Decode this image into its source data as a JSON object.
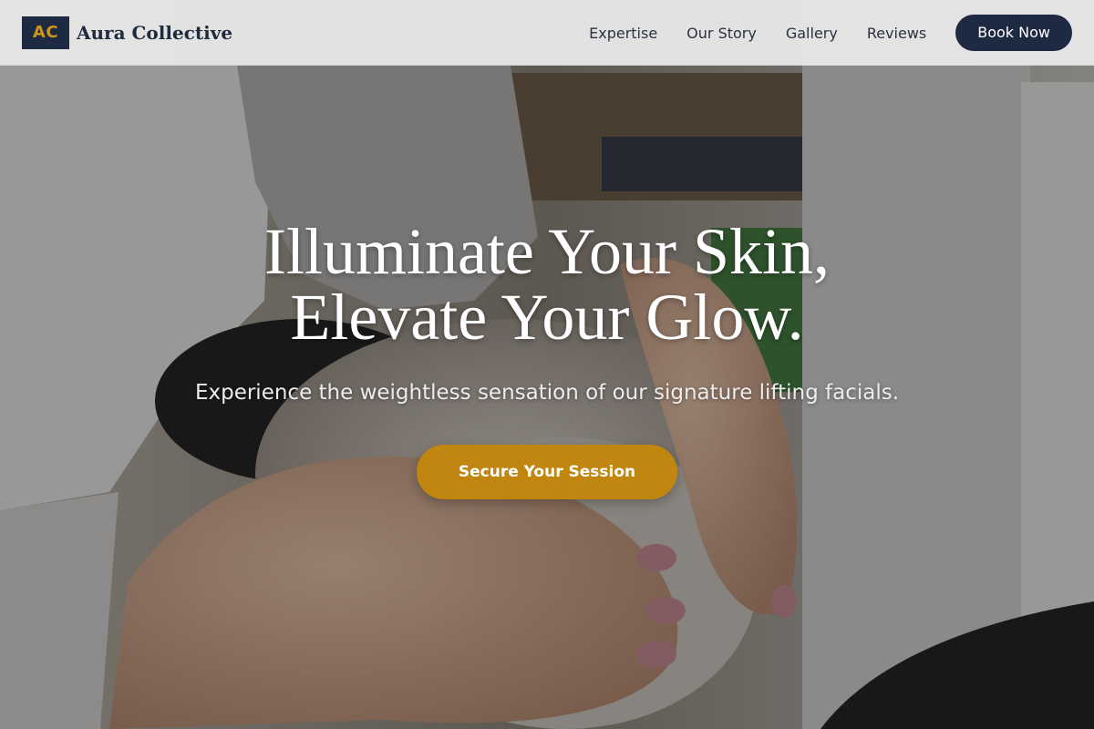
{
  "brand": {
    "logo_initials": "AC",
    "name": "Aura Collective"
  },
  "nav": {
    "items": [
      {
        "label": "Expertise"
      },
      {
        "label": "Our Story"
      },
      {
        "label": "Gallery"
      },
      {
        "label": "Reviews"
      }
    ],
    "book_label": "Book Now"
  },
  "hero": {
    "title_line_1": "Illuminate Your Skin,",
    "title_line_2": "Elevate Your Glow.",
    "subtitle": "Experience the weightless sensation of our signature lifting facials.",
    "cta_label": "Secure Your Session",
    "image_subject": "facial treatment hands on client face"
  },
  "colors": {
    "navy": "#1e2a42",
    "gold": "#c0860f",
    "header_bg": "#ececec"
  }
}
